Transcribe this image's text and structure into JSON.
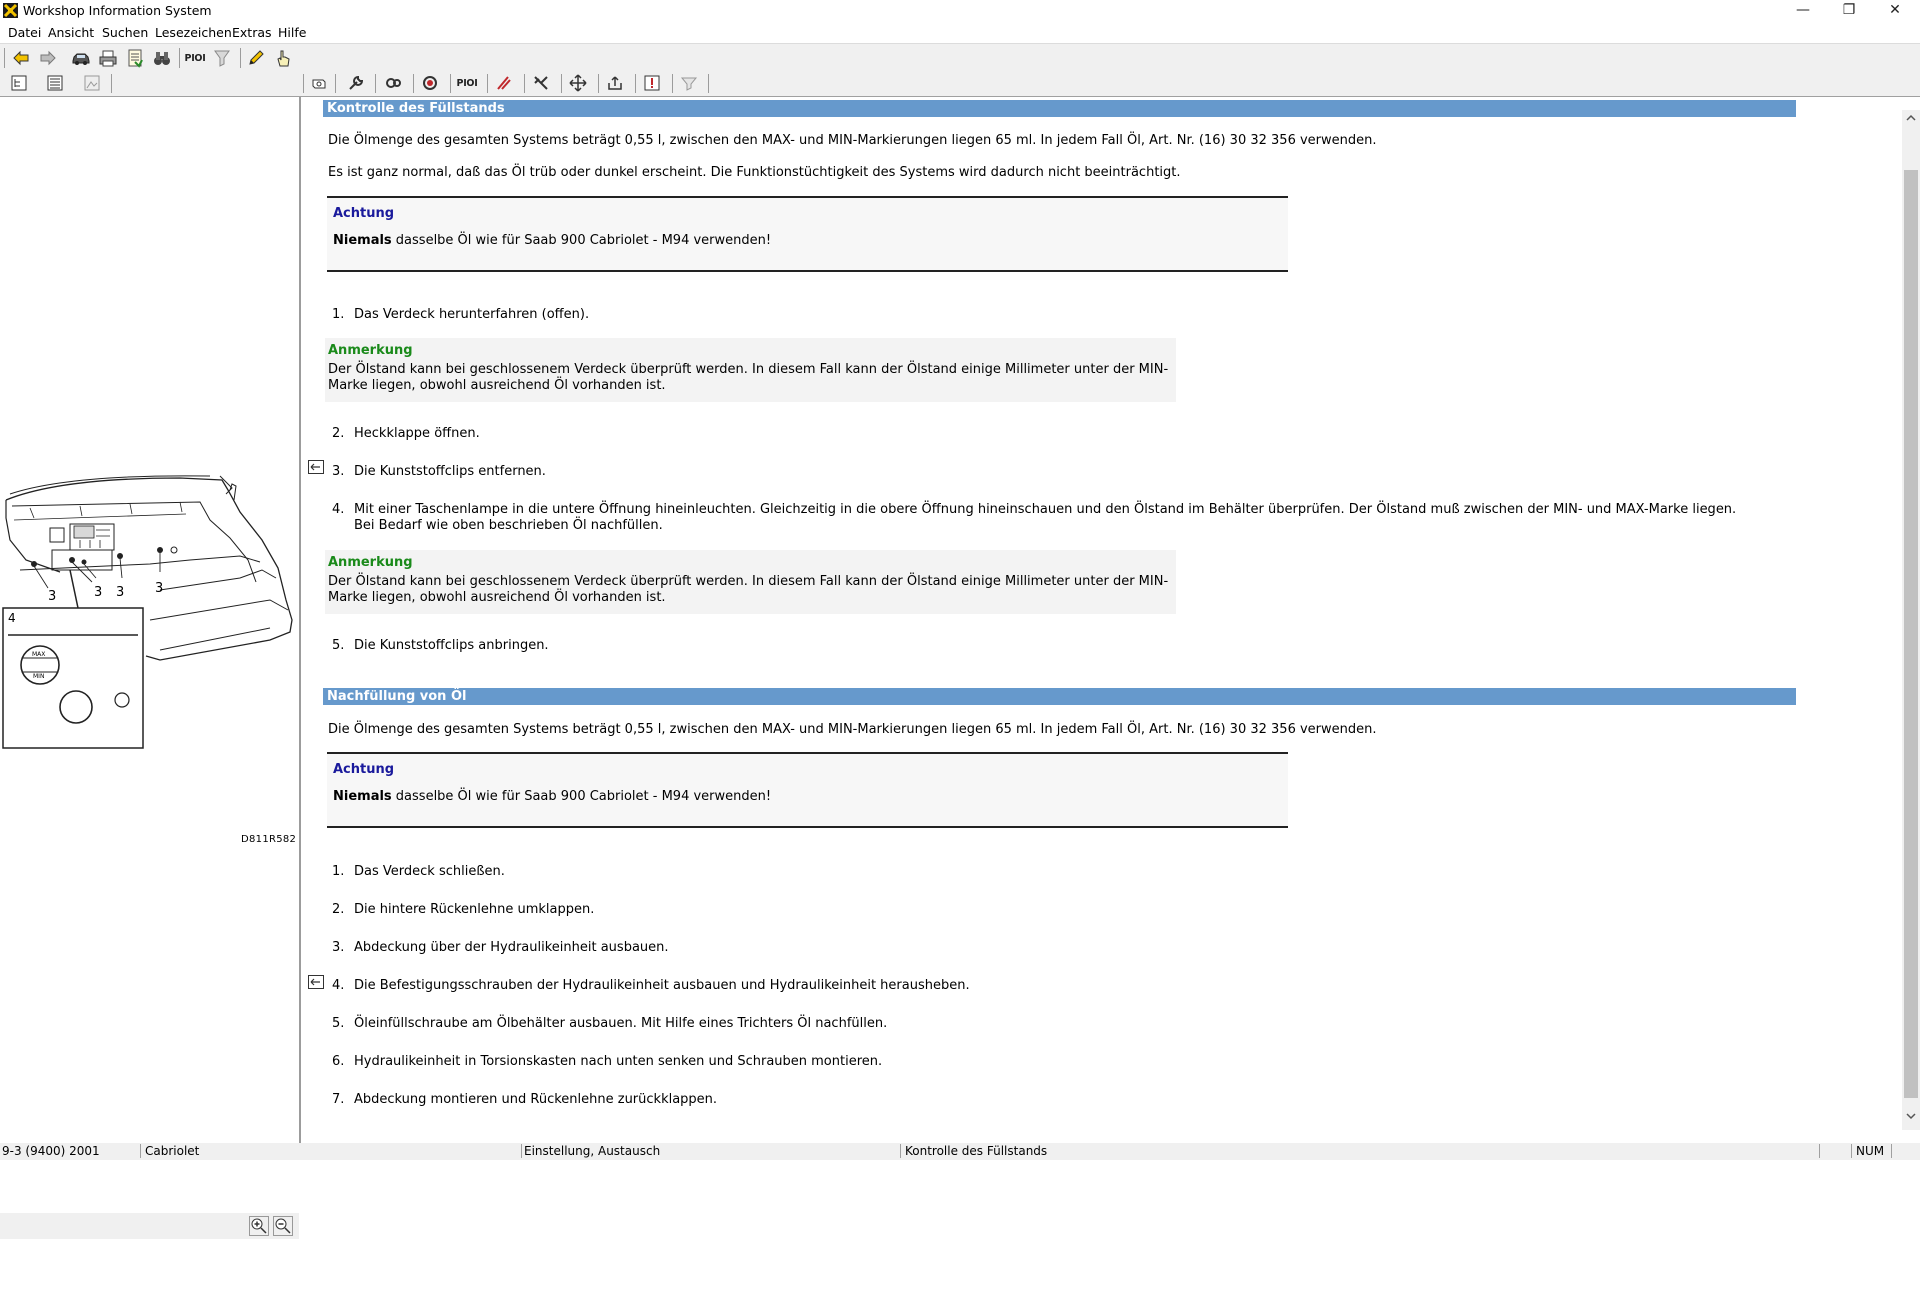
{
  "window": {
    "title": "Workshop Information System",
    "controls": {
      "minimize": "—",
      "restore": "❐",
      "close": "✕"
    }
  },
  "menu": [
    "Datei",
    "Ansicht",
    "Suchen",
    "Lesezeichen",
    "Extras",
    "Hilfe"
  ],
  "toolbar": {
    "pio_label": "PIOI",
    "icons_row1": [
      "back-arrow-icon",
      "forward-arrow-icon",
      "car-icon",
      "printer-icon",
      "document-list-icon",
      "binoculars-icon",
      "pio-icon",
      "filter-icon",
      "pencil-icon",
      "pointer-hand-icon"
    ],
    "icons_row2": [
      "tree-view-icon",
      "list-view-icon",
      "image-view-icon",
      "engine-icon",
      "wrench-icon",
      "gears-icon",
      "brake-icon",
      "pio-icon",
      "diagnostic-icon",
      "tools-icon",
      "move-icon",
      "export-icon",
      "warning-icon",
      "filter-icon"
    ]
  },
  "illustration": {
    "caption": "D811R582",
    "callout_number": "4",
    "labels": [
      "3",
      "3",
      "3",
      "3"
    ],
    "gauge_labels": [
      "MAX",
      "MIN"
    ]
  },
  "section1": {
    "header": "Kontrolle des Füllstands",
    "intro": "Die Ölmenge des gesamten Systems beträgt 0,55 l, zwischen den MAX- und MIN-Markierungen liegen 65 ml. In jedem Fall Öl, Art. Nr. (16) 30 32 356 verwenden.",
    "intro2": "Es ist ganz normal, daß das Öl trüb oder dunkel erscheint. Die Funktionstüchtigkeit des Systems wird dadurch nicht beeinträchtigt.",
    "warning": {
      "title": "Achtung",
      "bold": "Niemals",
      "text": " dasselbe Öl wie für Saab 900 Cabriolet - M94 verwenden!"
    },
    "steps": [
      {
        "num": "1.",
        "text": "Das Verdeck herunterfahren (offen)."
      },
      {
        "num": "2.",
        "text": "Heckklappe öffnen."
      },
      {
        "num": "3.",
        "text": "Die Kunststoffclips entfernen."
      },
      {
        "num": "4.",
        "text": "Mit einer Taschenlampe in die untere Öffnung hineinleuchten. Gleichzeitig in die obere Öffnung hineinschauen und den Ölstand im Behälter überprüfen. Der Ölstand muß zwischen der MIN- und MAX-Marke liegen.",
        "text2": "Bei Bedarf wie oben beschrieben Öl nachfüllen."
      },
      {
        "num": "5.",
        "text": "Die Kunststoffclips anbringen."
      }
    ],
    "note1": {
      "title": "Anmerkung",
      "text": "Der Ölstand kann bei geschlossenem Verdeck überprüft werden. In diesem Fall kann der Ölstand einige Millimeter unter der MIN-Marke liegen, obwohl ausreichend Öl vorhanden ist."
    },
    "note2": {
      "title": "Anmerkung",
      "text": "Der Ölstand kann bei geschlossenem Verdeck überprüft werden. In diesem Fall kann der Ölstand einige Millimeter unter der MIN-Marke liegen, obwohl ausreichend Öl vorhanden ist."
    }
  },
  "section2": {
    "header": "Nachfüllung von Öl",
    "intro": "Die Ölmenge des gesamten Systems beträgt 0,55 l, zwischen den MAX- und MIN-Markierungen liegen 65 ml. In jedem Fall Öl, Art. Nr. (16) 30 32 356 verwenden.",
    "warning": {
      "title": "Achtung",
      "bold": "Niemals",
      "text": " dasselbe Öl wie für Saab 900 Cabriolet - M94 verwenden!"
    },
    "steps": [
      {
        "num": "1.",
        "text": "Das Verdeck schließen."
      },
      {
        "num": "2.",
        "text": "Die hintere Rückenlehne umklappen."
      },
      {
        "num": "3.",
        "text": "Abdeckung über der Hydraulikeinheit ausbauen."
      },
      {
        "num": "4.",
        "text": "Die Befestigungsschrauben der Hydraulikeinheit ausbauen und Hydraulikeinheit herausheben."
      },
      {
        "num": "5.",
        "text": "Öleinfüllschraube am Ölbehälter ausbauen. Mit Hilfe eines Trichters Öl nachfüllen."
      },
      {
        "num": "6.",
        "text": "Hydraulikeinheit in Torsionskasten nach unten senken und Schrauben montieren."
      },
      {
        "num": "7.",
        "text": "Abdeckung montieren und Rückenlehne zurückklappen."
      }
    ]
  },
  "statusbar": {
    "model": "9-3 (9400) 2001",
    "body": "Cabriolet",
    "category": "Einstellung, Austausch",
    "topic": "Kontrolle des Füllstands",
    "empty": "",
    "num": "NUM"
  },
  "colors": {
    "section_header": "#6699cc",
    "warning_title": "#1a1a9c",
    "note_title": "#1a8a1a",
    "chrome": "#f0f0f0"
  }
}
